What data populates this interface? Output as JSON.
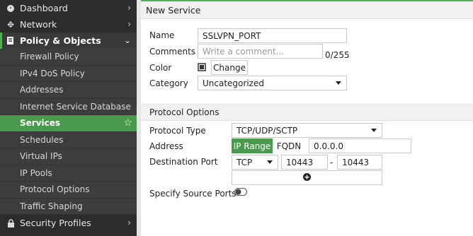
{
  "sidebar": {
    "top_items": [
      {
        "label": "Dashboard"
      },
      {
        "label": "Network"
      },
      {
        "label": "Policy & Objects"
      }
    ],
    "sub_items": [
      {
        "label": "Firewall Policy"
      },
      {
        "label": "IPv4 DoS Policy"
      },
      {
        "label": "Addresses"
      },
      {
        "label": "Internet Service Database"
      },
      {
        "label": "Services"
      },
      {
        "label": "Schedules"
      },
      {
        "label": "Virtual IPs"
      },
      {
        "label": "IP Pools"
      },
      {
        "label": "Protocol Options"
      },
      {
        "label": "Traffic Shaping"
      }
    ],
    "bottom_item": {
      "label": "Security Profiles"
    }
  },
  "header": {
    "title": "New Service"
  },
  "form": {
    "name_label": "Name",
    "name_value": "SSLVPN_PORT",
    "comments_label": "Comments",
    "comments_placeholder": "Write a comment...",
    "comments_count": "0/255",
    "color_label": "Color",
    "color_button": "Change",
    "category_label": "Category",
    "category_value": "Uncategorized"
  },
  "protocol": {
    "section_title": "Protocol Options",
    "type_label": "Protocol Type",
    "type_value": "TCP/UDP/SCTP",
    "address_label": "Address",
    "address_mode_iprange": "IP Range",
    "address_mode_fqdn": "FQDN",
    "address_value": "0.0.0.0",
    "dest_port_label": "Destination Port",
    "dest_protocol": "TCP",
    "port_low": "10443",
    "port_separator": "-",
    "port_high": "10443",
    "source_ports_label": "Specify Source Ports"
  },
  "colors": {
    "accent": "#4a9a4e",
    "sidebar_bg": "#2c2c2c"
  }
}
